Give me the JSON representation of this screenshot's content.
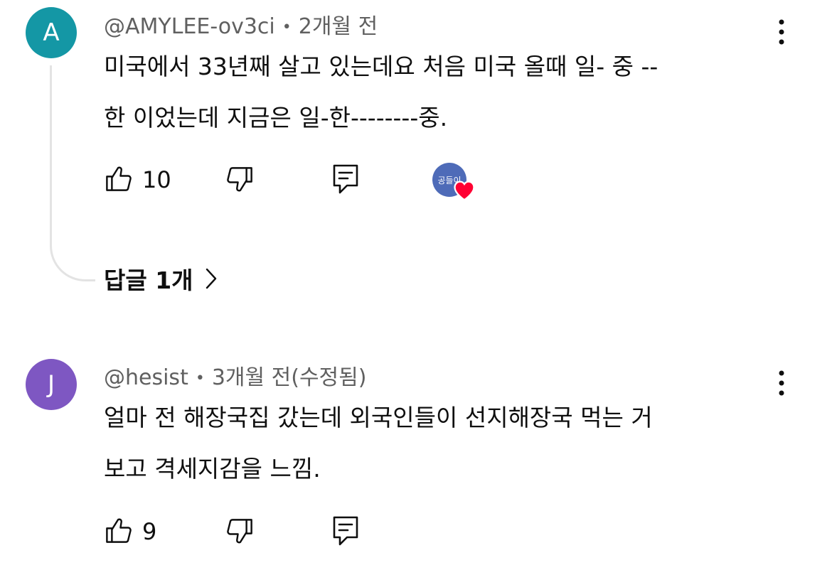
{
  "colors": {
    "avatar_a": "#1497a5",
    "avatar_j": "#7e57c2",
    "badge_bg": "#4e6bb8",
    "heart": "#ff0033"
  },
  "comments": [
    {
      "avatar_letter": "A",
      "handle": "@AMYLEE-ov3ci",
      "time": "2개월 전",
      "line1": "미국에서 33년째 살고 있는데요 처음 미국 올때 일- 중 --",
      "line2": "한 이었는데 지금은 일-한--------중.",
      "likes": "10",
      "creator_badge_text": "공들이",
      "replies_label": "답글 1개"
    },
    {
      "avatar_letter": "J",
      "handle": "@hesist",
      "time": "3개월 전(수정됨)",
      "line1": "얼마 전 해장국집 갔는데 외국인들이 선지해장국 먹는 거",
      "line2": "보고 격세지감을 느낌.",
      "likes": "9"
    }
  ],
  "icons": {
    "like": "thumbs-up-icon",
    "dislike": "thumbs-down-icon",
    "reply": "comment-reply-icon",
    "more": "more-vert-icon",
    "chevron": "chevron-right-icon",
    "heart": "heart-icon"
  }
}
